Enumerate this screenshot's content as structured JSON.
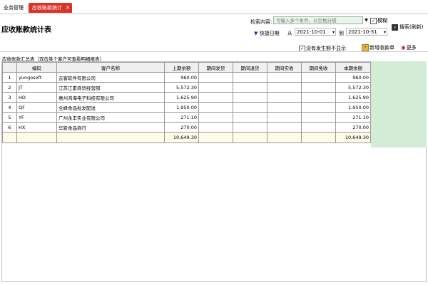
{
  "tabs": [
    {
      "label": "业务管理"
    },
    {
      "label": "应收账款统计",
      "close": "✕"
    }
  ],
  "page_title": "应收账款统计表",
  "search": {
    "label": "检索内容:",
    "placeholder": "可输入多个条件，以空格分隔",
    "fuzzy_label": "模糊",
    "button_label": "搜索(刷新)"
  },
  "quick_date": {
    "label": "快捷日期",
    "from_label": "从",
    "from": "2021-10-01",
    "to_label": "到",
    "to": "2021-10-31"
  },
  "options": {
    "hide_no_occurrence": "没有发生额不显示",
    "new_receipt": "新增收款单",
    "more": "更多"
  },
  "table_caption": "应收账款汇总表（双击某个客户可查看明细报表）",
  "columns": [
    "编码",
    "客户名称",
    "上期余额",
    "期间发货",
    "期间退货",
    "期间实收",
    "期间免收",
    "本期余额"
  ],
  "rows": [
    {
      "idx": "1",
      "code": "yungosoft",
      "name": "云客软件有限公司",
      "prev": "960.00",
      "ship": "",
      "ret": "",
      "recv": "",
      "free": "",
      "cur": "960.00"
    },
    {
      "idx": "2",
      "code": "JT",
      "name": "江苏江素商贸经营部",
      "prev": "5,572.30",
      "ship": "",
      "ret": "",
      "recv": "",
      "free": "",
      "cur": "5,572.30"
    },
    {
      "idx": "3",
      "code": "HD",
      "name": "惠州鸿海电子科技有限公司",
      "prev": "1,625.90",
      "ship": "",
      "ret": "",
      "recv": "",
      "free": "",
      "cur": "1,625.90"
    },
    {
      "idx": "4",
      "code": "QF",
      "name": "全峰食品批发配送",
      "prev": "1,950.00",
      "ship": "",
      "ret": "",
      "recv": "",
      "free": "",
      "cur": "1,950.00"
    },
    {
      "idx": "5",
      "code": "YF",
      "name": "广州永丰实业有限公司",
      "prev": "271.10",
      "ship": "",
      "ret": "",
      "recv": "",
      "free": "",
      "cur": "271.10"
    },
    {
      "idx": "6",
      "code": "HX",
      "name": "华新食品商行",
      "prev": "270.00",
      "ship": "",
      "ret": "",
      "recv": "",
      "free": "",
      "cur": "270.00"
    }
  ],
  "totals": {
    "prev": "10,649.30",
    "cur": "10,649.30"
  }
}
